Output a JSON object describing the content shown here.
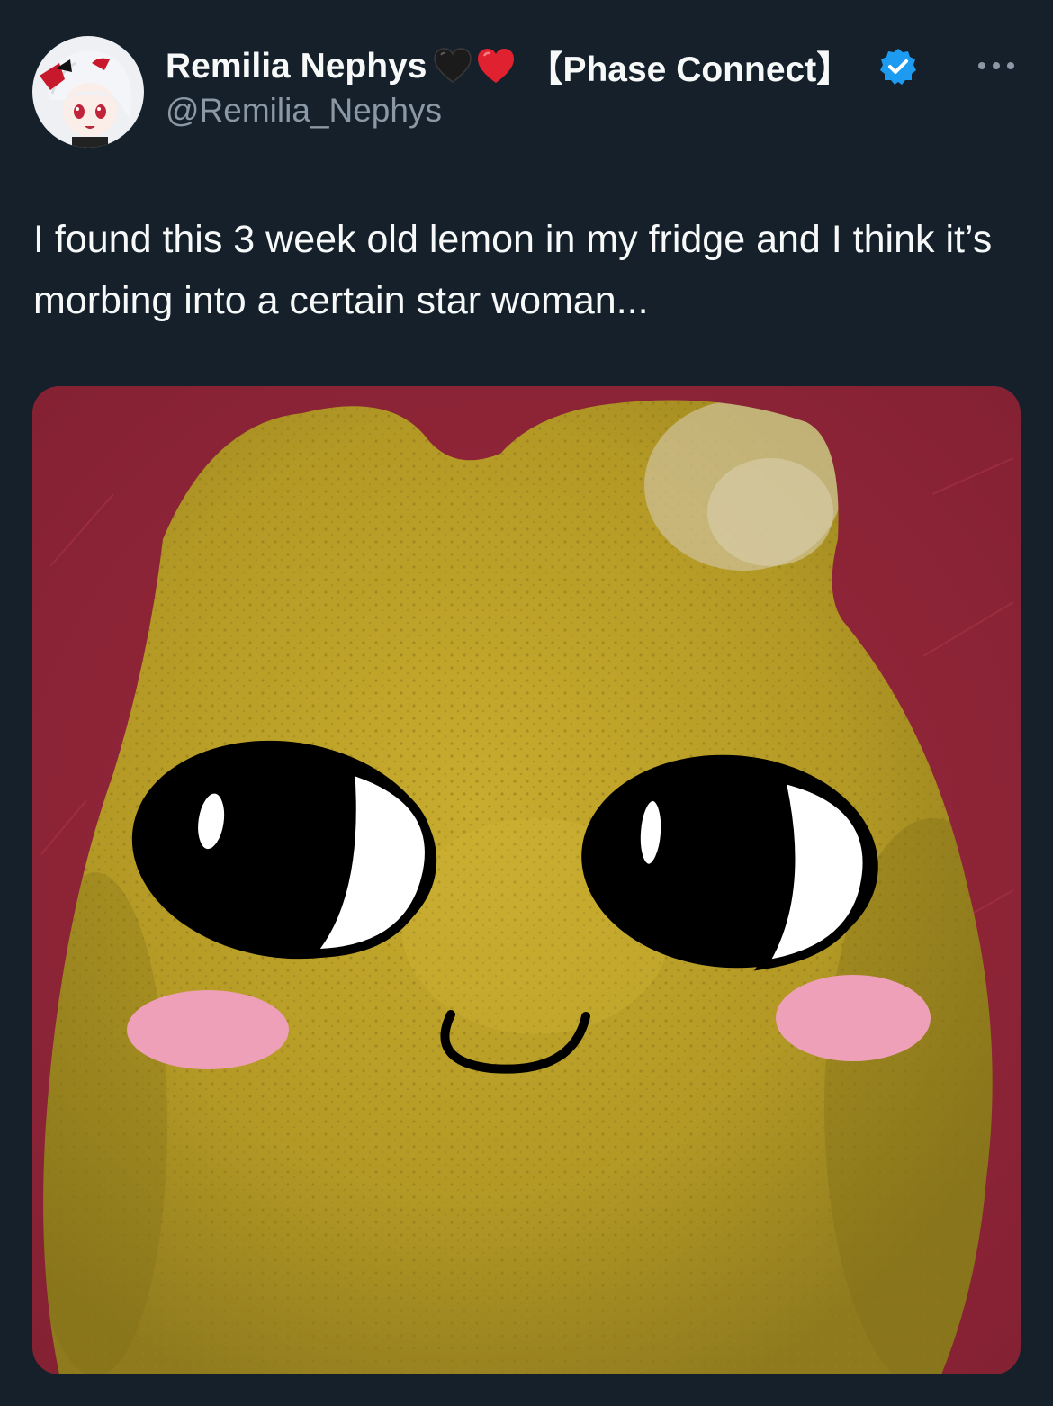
{
  "tweet": {
    "author": {
      "display_name": "Remilia Nephys",
      "name_emojis": [
        "black-heart-icon",
        "red-heart-icon"
      ],
      "affiliation": "【Phase Connect】",
      "handle": "@Remilia_Nephys",
      "verified": true,
      "verified_color": "#1d9bf0"
    },
    "text": "I found this 3 week old lemon in my fridge and I think it’s morbing into a certain star woman...",
    "media": {
      "kind": "photo",
      "description_icon": "lemon-with-drawn-face-image",
      "background_color": "#8e2537",
      "lemon_color": "#b99d27"
    },
    "actions": {
      "more_icon": "more-options-icon"
    }
  },
  "theme": {
    "background": "#15202b",
    "text_primary": "#f7f9f9",
    "text_secondary": "#8b98a5"
  }
}
